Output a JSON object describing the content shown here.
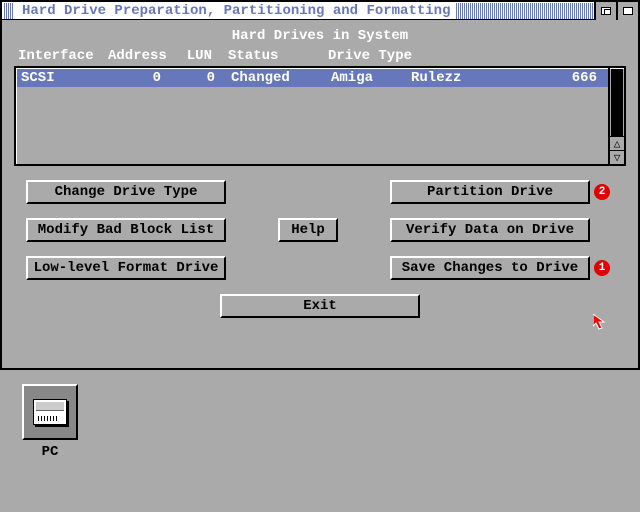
{
  "window": {
    "title": "Hard Drive Preparation, Partitioning and Formatting"
  },
  "panel": {
    "heading": "Hard Drives in System",
    "headers": {
      "interface": "Interface",
      "address": "Address",
      "lun": "LUN",
      "status": "Status",
      "drivetype": "Drive Type"
    },
    "rows": [
      {
        "interface": "SCSI",
        "address": "0",
        "lun": "0",
        "status": "Changed",
        "type_a": "Amiga",
        "type_b": "Rulezz",
        "type_c": "666"
      }
    ]
  },
  "buttons": {
    "change_drive_type": "Change Drive Type",
    "partition_drive": "Partition Drive",
    "modify_bad_block": "Modify Bad Block List",
    "help": "Help",
    "verify_data": "Verify Data on Drive",
    "low_level_format": "Low-level Format Drive",
    "save_changes": "Save Changes to Drive",
    "exit": "Exit"
  },
  "badges": {
    "partition": "2",
    "save": "1"
  },
  "desktop": {
    "pc_label": "PC"
  }
}
